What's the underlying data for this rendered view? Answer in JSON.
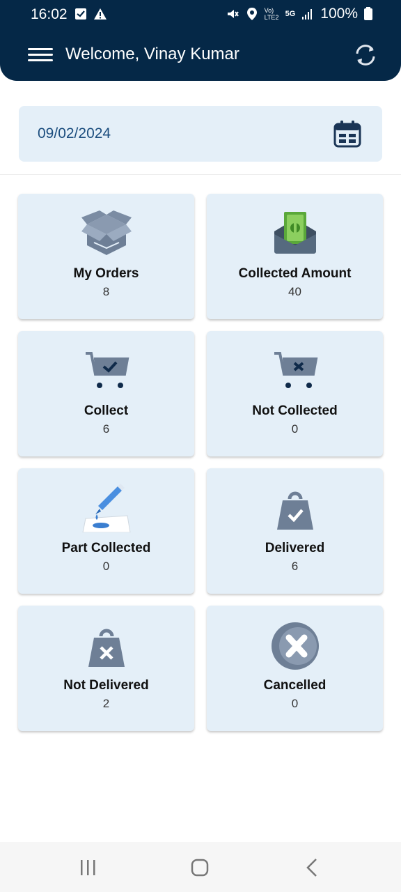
{
  "status_bar": {
    "time": "16:02",
    "battery": "100%",
    "network": "5G",
    "carrier": "Vo) LTE2"
  },
  "header": {
    "title": "Welcome, Vinay Kumar"
  },
  "date_field": {
    "value": "09/02/2024"
  },
  "cards": [
    {
      "label": "My Orders",
      "count": "8",
      "icon": "box-icon"
    },
    {
      "label": "Collected Amount",
      "count": "40",
      "icon": "cash-envelope-icon"
    },
    {
      "label": "Collect",
      "count": "6",
      "icon": "cart-check-icon"
    },
    {
      "label": "Not Collected",
      "count": "0",
      "icon": "cart-x-icon"
    },
    {
      "label": "Part Collected",
      "count": "0",
      "icon": "pen-drop-icon"
    },
    {
      "label": "Delivered",
      "count": "6",
      "icon": "bag-check-icon"
    },
    {
      "label": "Not Delivered",
      "count": "2",
      "icon": "bag-x-icon"
    },
    {
      "label": "Cancelled",
      "count": "0",
      "icon": "cancel-circle-icon"
    }
  ],
  "colors": {
    "header_bg": "#052847",
    "card_bg": "#e4eff8",
    "icon_gray": "#6e7f96",
    "icon_dark": "#0f2a4a",
    "date_text": "#1b4d7e"
  }
}
